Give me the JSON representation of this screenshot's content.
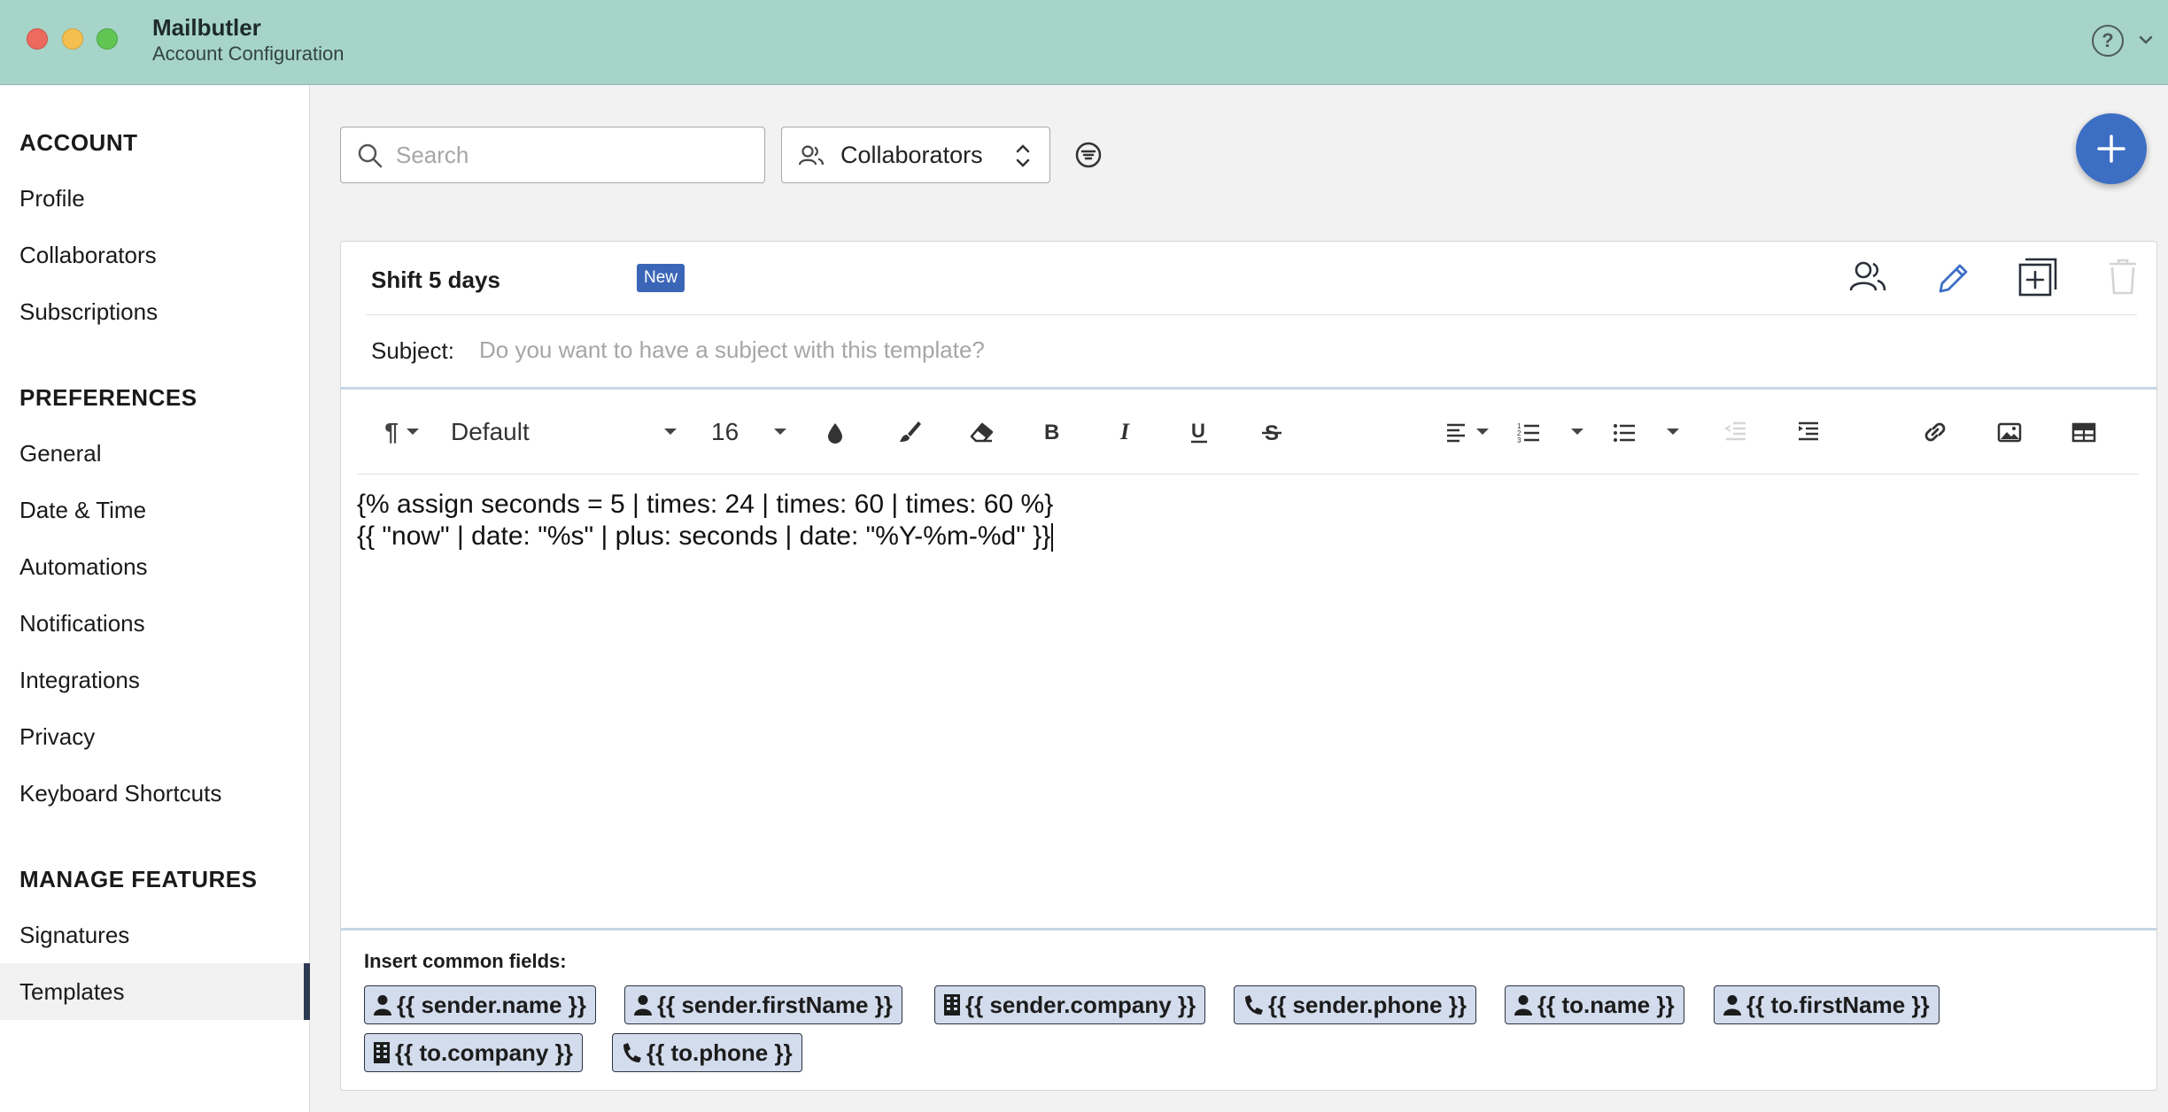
{
  "window": {
    "app_title": "Mailbutler",
    "subtitle": "Account Configuration",
    "help_label": "?"
  },
  "sidebar": {
    "sections": [
      {
        "heading": "ACCOUNT",
        "items": [
          "Profile",
          "Collaborators",
          "Subscriptions"
        ]
      },
      {
        "heading": "PREFERENCES",
        "items": [
          "General",
          "Date & Time",
          "Automations",
          "Notifications",
          "Integrations",
          "Privacy",
          "Keyboard Shortcuts"
        ]
      },
      {
        "heading": "MANAGE FEATURES",
        "items": [
          "Signatures",
          "Templates"
        ]
      }
    ],
    "active_item": "Templates"
  },
  "toolbar": {
    "search_placeholder": "Search",
    "search_value": "",
    "collaborators_select": "Collaborators",
    "add_icon": "plus-icon",
    "filter_icon": "filter-icon"
  },
  "template": {
    "name": "Shift 5 days",
    "badge": "New",
    "subject_label": "Subject:",
    "subject_placeholder": "Do you want to have a subject with this template?",
    "subject_value": "",
    "actions": [
      "collaborators-icon",
      "pencil-icon",
      "duplicate-icon",
      "trash-icon"
    ]
  },
  "editor": {
    "paragraph_icon": "¶",
    "font_family": "Default",
    "font_size": "16",
    "content_lines": [
      "{% assign seconds = 5 | times: 24 | times: 60 | times: 60 %}",
      "{{ \"now\" | date: \"%s\" | plus: seconds | date: \"%Y-%m-%d\" }}"
    ]
  },
  "common_fields": {
    "label": "Insert common fields:",
    "chips": [
      {
        "text": "{{ sender.name }}",
        "icon": "person-icon"
      },
      {
        "text": "{{ sender.firstName }}",
        "icon": "person-icon"
      },
      {
        "text": "{{ sender.company }}",
        "icon": "building-icon"
      },
      {
        "text": "{{ sender.phone }}",
        "icon": "phone-icon"
      },
      {
        "text": "{{ to.name }}",
        "icon": "person-icon"
      },
      {
        "text": "{{ to.firstName }}",
        "icon": "person-icon"
      },
      {
        "text": "{{ to.company }}",
        "icon": "building-icon"
      },
      {
        "text": "{{ to.phone }}",
        "icon": "phone-icon"
      }
    ]
  },
  "colors": {
    "titlebar": "#a6d4c8",
    "accent": "#3c6fc4",
    "badge": "#3b66b8",
    "chip_bg": "#d3dcec"
  }
}
